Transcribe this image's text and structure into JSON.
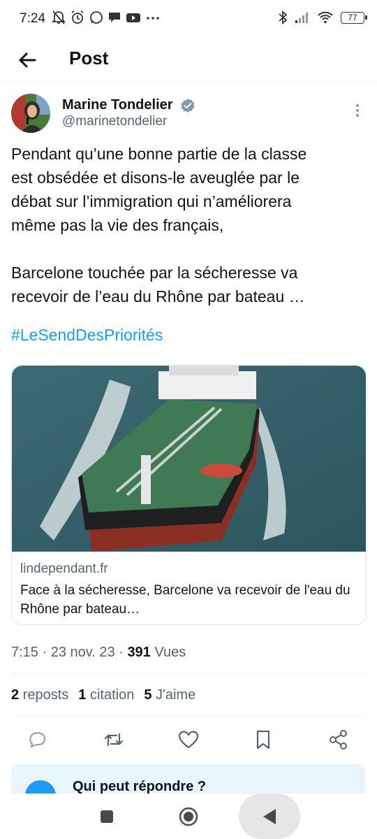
{
  "status_bar": {
    "time": "7:24",
    "battery": "77"
  },
  "header": {
    "title": "Post"
  },
  "author": {
    "name": "Marine Tondelier",
    "handle": "@marinetondelier"
  },
  "tweet": {
    "text": "Pendant qu’une bonne partie de la classe\nest obsédée et disons-le aveuglée par le\ndébat sur l’immigration qui n’améliorera\nmême pas la vie des français,\n\nBarcelone touchée par la sécheresse va\nrecevoir de l’eau du Rhône par bateau …",
    "hashtag": "#LeSendDesPriorités"
  },
  "link_card": {
    "domain": "lindependant.fr",
    "title": "Face à la sécheresse, Barcelone va recevoir de l'eau du Rhône par bateau…"
  },
  "meta": {
    "time": "7:15",
    "sep1": " · ",
    "date": "23 nov. 23",
    "sep2": " · ",
    "views_count": "391",
    "views_label": " Vues"
  },
  "stats": {
    "reposts_count": "2",
    "reposts_label": " reposts",
    "quotes_count": "1",
    "quotes_label": " citation",
    "likes_count": "5",
    "likes_label": " J'aime"
  },
  "reply_settings": {
    "title": "Qui peut répondre ?"
  },
  "colors": {
    "accent": "#1d9bf0",
    "secondary_text": "#536471",
    "reply_box_bg": "#e8f5fd"
  }
}
